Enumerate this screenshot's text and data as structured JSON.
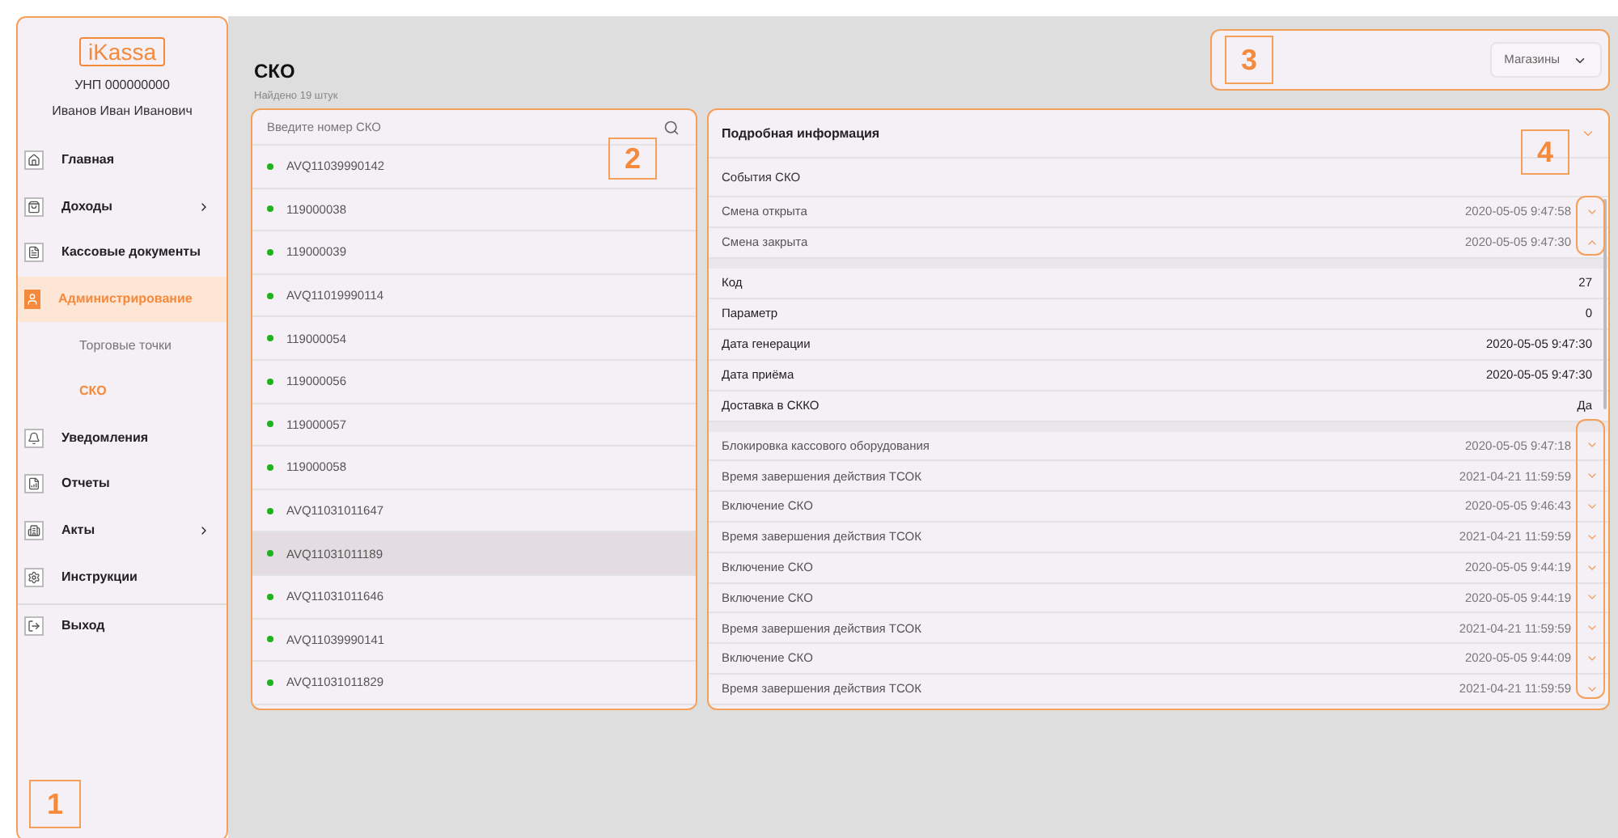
{
  "sidebar": {
    "logo": "iKassa",
    "unp": "УНП 000000000",
    "user": "Иванов Иван Иванович",
    "items": [
      {
        "kind": "link",
        "label": "Главная",
        "selected": false
      },
      {
        "kind": "group",
        "label": "Доходы",
        "selected": false,
        "expanded": false
      },
      {
        "kind": "link",
        "label": "Кассовые документы",
        "selected": false
      },
      {
        "kind": "group",
        "label": "Администрирование",
        "selected": true,
        "expanded": true,
        "children": [
          {
            "label": "Торговые точки",
            "selected": false
          },
          {
            "label": "СКО",
            "selected": true
          }
        ]
      },
      {
        "kind": "link",
        "label": "Уведомления",
        "selected": false
      },
      {
        "kind": "link",
        "label": "Отчеты",
        "selected": false
      },
      {
        "kind": "group",
        "label": "Акты",
        "selected": false,
        "expanded": false
      },
      {
        "kind": "link",
        "label": "Инструкции",
        "selected": false
      }
    ],
    "logout": "Выход"
  },
  "page": {
    "title": "СКО",
    "count": "Найдено 19 штук"
  },
  "filter": {
    "value": "Магазины"
  },
  "list": {
    "placeholder": "Введите номер СКО",
    "items": [
      {
        "number": "AVQ11039990142",
        "color": "#1db31d",
        "selected": false
      },
      {
        "number": "119000038",
        "color": "#1db31d",
        "selected": false
      },
      {
        "number": "119000039",
        "color": "#1db31d",
        "selected": false
      },
      {
        "number": "AVQ11019990114",
        "color": "#1db31d",
        "selected": false
      },
      {
        "number": "119000054",
        "color": "#1db31d",
        "selected": false
      },
      {
        "number": "119000056",
        "color": "#1db31d",
        "selected": false
      },
      {
        "number": "119000057",
        "color": "#1db31d",
        "selected": false
      },
      {
        "number": "119000058",
        "color": "#1db31d",
        "selected": false
      },
      {
        "number": "AVQ11031011647",
        "color": "#1db31d",
        "selected": false
      },
      {
        "number": "AVQ11031011189",
        "color": "#1db31d",
        "selected": true
      },
      {
        "number": "AVQ11031011646",
        "color": "#1db31d",
        "selected": false
      },
      {
        "number": "AVQ11039990141",
        "color": "#1db31d",
        "selected": false
      },
      {
        "number": "AVQ11031011829",
        "color": "#1db31d",
        "selected": false
      }
    ]
  },
  "details": {
    "title": "Подробная информация",
    "section": "События СКО",
    "events": [
      {
        "name": "Смена открыта",
        "time": "2020-05-05 9:47:58",
        "expanded": false
      },
      {
        "name": "Смена закрыта",
        "time": "2020-05-05 9:47:30",
        "expanded": true,
        "fields": [
          {
            "label": "Код",
            "value": "27"
          },
          {
            "label": "Параметр",
            "value": "0"
          },
          {
            "label": "Дата генерации",
            "value": "2020-05-05 9:47:30"
          },
          {
            "label": "Дата приёма",
            "value": "2020-05-05 9:47:30"
          },
          {
            "label": "Доставка в СККО",
            "value": "Да"
          }
        ]
      },
      {
        "name": "Блокировка кассового оборудования",
        "time": "2020-05-05 9:47:18",
        "expanded": false
      },
      {
        "name": "Время завершения действия ТСОК",
        "time": "2021-04-21 11:59:59",
        "expanded": false
      },
      {
        "name": "Включение СКО",
        "time": "2020-05-05 9:46:43",
        "expanded": false
      },
      {
        "name": "Время завершения действия ТСОК",
        "time": "2021-04-21 11:59:59",
        "expanded": false
      },
      {
        "name": "Включение СКО",
        "time": "2020-05-05 9:44:19",
        "expanded": false
      },
      {
        "name": "Включение СКО",
        "time": "2020-05-05 9:44:19",
        "expanded": false
      },
      {
        "name": "Время завершения действия ТСОК",
        "time": "2021-04-21 11:59:59",
        "expanded": false
      },
      {
        "name": "Включение СКО",
        "time": "2020-05-05 9:44:09",
        "expanded": false
      },
      {
        "name": "Время завершения действия ТСОК",
        "time": "2021-04-21 11:59:59",
        "expanded": false
      }
    ]
  },
  "annotations": [
    {
      "label": "1"
    },
    {
      "label": "2"
    },
    {
      "label": "3"
    },
    {
      "label": "4"
    }
  ]
}
